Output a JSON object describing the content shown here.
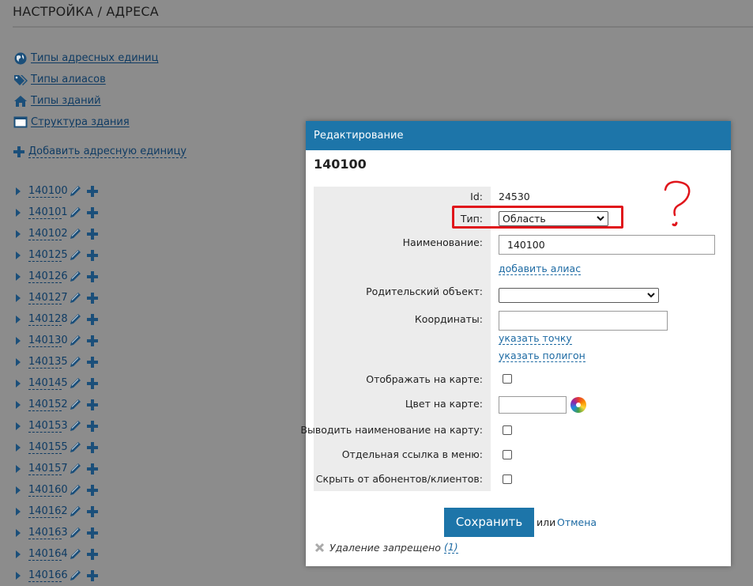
{
  "page": {
    "title": "НАСТРОЙКА / АДРЕСА"
  },
  "links": [
    {
      "label": "Типы адресных единиц",
      "icon": "globe-icon"
    },
    {
      "label": "Типы алиасов",
      "icon": "tags-icon"
    },
    {
      "label": "Типы зданий",
      "icon": "home-icon"
    },
    {
      "label": "Структура здания",
      "icon": "window-icon"
    }
  ],
  "add_unit": {
    "label": "Добавить адресную единицу",
    "icon": "plus-icon"
  },
  "tree": [
    "140100",
    "140101",
    "140102",
    "140125",
    "140126",
    "140127",
    "140128",
    "140130",
    "140135",
    "140145",
    "140152",
    "140153",
    "140155",
    "140157",
    "140160",
    "140162",
    "140163",
    "140164",
    "140166"
  ],
  "modal": {
    "header": "Редактирование",
    "subtitle": "140100",
    "fields": {
      "id_label": "Id:",
      "id_value": "24530",
      "type_label": "Тип:",
      "type_value": "Область",
      "name_label": "Наименование:",
      "name_value": "140100",
      "add_alias": "добавить алиас",
      "parent_label": "Родительский объект:",
      "parent_value": "",
      "coords_label": "Координаты:",
      "coords_value": "",
      "set_point": "указать точку",
      "set_polygon": "указать полигон",
      "show_on_map_label": "Отображать на карте:",
      "color_label": "Цвет на карте:",
      "color_value": "",
      "show_name_label": "Выводить наименование на карту:",
      "menu_link_label": "Отдельная ссылка в меню:",
      "hide_label": "Скрыть от абонентов/клиентов:"
    },
    "checkboxes": {
      "show_on_map": false,
      "show_name": false,
      "menu_link": false,
      "hide": false
    },
    "save": "Сохранить",
    "or": "или",
    "cancel": "Отмена",
    "delete_text": "Удаление запрещено",
    "delete_count": "(1)"
  },
  "annotation": {
    "mark": "?",
    "color": "#e0151b"
  },
  "colors": {
    "accent": "#1d75a9",
    "link": "#0f3b63",
    "overlay": "#8c8c8c"
  }
}
